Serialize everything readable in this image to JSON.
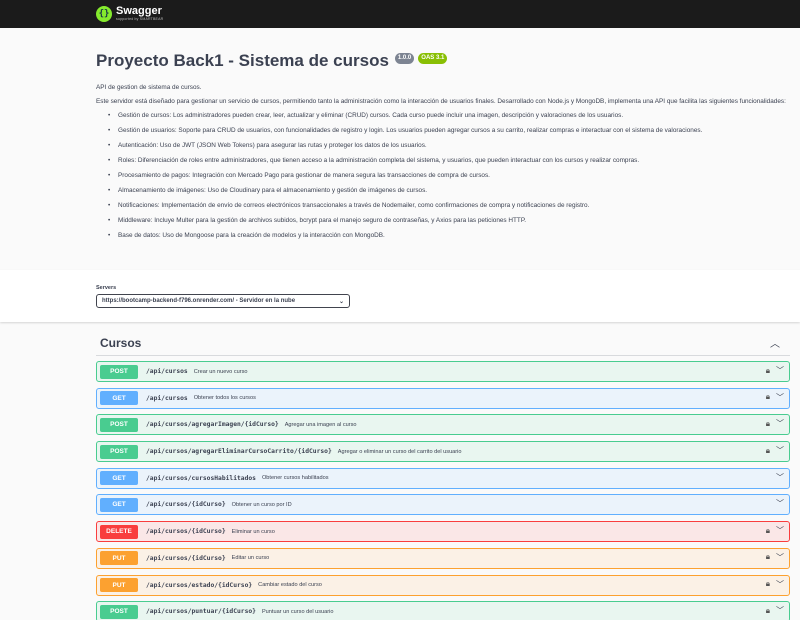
{
  "topbar": {
    "logo_name": "Swagger",
    "logo_sub": "supported by SMARTBEAR"
  },
  "info": {
    "title": "Proyecto Back1 - Sistema de cursos",
    "version": "1.0.0",
    "oas": "OAS 3.1",
    "summary": "API de gestion de sistema de cursos.",
    "description": "Este servidor está diseñado para gestionar un servicio de cursos, permitiendo tanto la administración como la interacción de usuarios finales. Desarrollado con Node.js y MongoDB, implementa una API que facilita las siguientes funcionalidades:",
    "features": [
      "Gestión de cursos: Los administradores pueden crear, leer, actualizar y eliminar (CRUD) cursos. Cada curso puede incluir una imagen, descripción y valoraciones de los usuarios.",
      "Gestión de usuarios: Soporte para CRUD de usuarios, con funcionalidades de registro y login. Los usuarios pueden agregar cursos a su carrito, realizar compras e interactuar con el sistema de valoraciones.",
      "Autenticación: Uso de JWT (JSON Web Tokens) para asegurar las rutas y proteger los datos de los usuarios.",
      "Roles: Diferenciación de roles entre administradores, que tienen acceso a la administración completa del sistema, y usuarios, que pueden interactuar con los cursos y realizar compras.",
      "Procesamiento de pagos: Integración con Mercado Pago para gestionar de manera segura las transacciones de compra de cursos.",
      "Almacenamiento de imágenes: Uso de Cloudinary para el almacenamiento y gestión de imágenes de cursos.",
      "Notificaciones: Implementación de envío de correos electrónicos transaccionales a través de Nodemailer, como confirmaciones de compra y notificaciones de registro.",
      "Middleware: Incluye Multer para la gestión de archivos subidos, bcrypt para el manejo seguro de contraseñas, y Axios para las peticiones HTTP.",
      "Base de datos: Uso de Mongoose para la creación de modelos y la interacción con MongoDB."
    ]
  },
  "servers": {
    "label": "Servers",
    "selected": "https://bootcamp-backend-f796.onrender.com/ - Servidor en la nube"
  },
  "section": {
    "title": "Cursos",
    "operations": [
      {
        "method": "POST",
        "path": "/api/cursos",
        "summary": "Crear un nuevo curso",
        "locked": true
      },
      {
        "method": "GET",
        "path": "/api/cursos",
        "summary": "Obtener todos los cursos",
        "locked": true
      },
      {
        "method": "POST",
        "path": "/api/cursos/agregarImagen/{idCurso}",
        "summary": "Agregar una imagen al curso",
        "locked": true
      },
      {
        "method": "POST",
        "path": "/api/cursos/agregarEliminarCursoCarrito/{idCurso}",
        "summary": "Agregar o eliminar un curso del carrito del usuario",
        "locked": true
      },
      {
        "method": "GET",
        "path": "/api/cursos/cursosHabilitados",
        "summary": "Obtener cursos habilitados",
        "locked": false
      },
      {
        "method": "GET",
        "path": "/api/cursos/{idCurso}",
        "summary": "Obtener un curso por ID",
        "locked": false
      },
      {
        "method": "DELETE",
        "path": "/api/cursos/{idCurso}",
        "summary": "Eliminar un curso",
        "locked": true
      },
      {
        "method": "PUT",
        "path": "/api/cursos/{idCurso}",
        "summary": "Editar un curso",
        "locked": true
      },
      {
        "method": "PUT",
        "path": "/api/cursos/estado/{idCurso}",
        "summary": "Cambiar estado del curso",
        "locked": true
      },
      {
        "method": "POST",
        "path": "/api/cursos/puntuar/{idCurso}",
        "summary": "Puntuar un curso del usuario",
        "locked": true
      }
    ]
  },
  "colors": {
    "post": "#49cc90",
    "get": "#61affe",
    "delete": "#f93e3e",
    "put": "#fca130",
    "topbar": "#1b1b1b"
  }
}
